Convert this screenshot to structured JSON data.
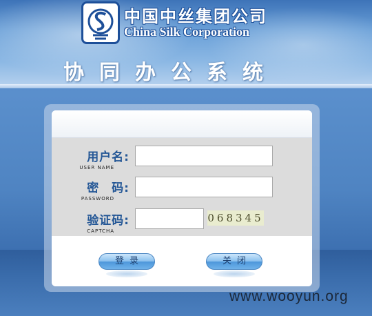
{
  "header": {
    "brand_cn": "中国中丝集团公司",
    "brand_en": "China Silk Corporation",
    "system_title": "协同办公系统"
  },
  "login": {
    "username": {
      "label_cn": "用户名:",
      "label_en": "USER NAME",
      "value": ""
    },
    "password": {
      "label_cn": "密　码:",
      "label_en": "PASSWORD",
      "value": ""
    },
    "captcha": {
      "label_cn": "验证码:",
      "label_en": "CAPTCHA",
      "value": "",
      "image_text": "068345"
    },
    "login_button": "登录",
    "close_button": "关闭"
  },
  "watermark": "www.wooyun.org",
  "colors": {
    "label_blue": "#245796",
    "brand_blue": "#1d4f99",
    "button_blue": "#6fb2ea"
  },
  "icons": {
    "logo": "china-silk-logo-icon"
  }
}
